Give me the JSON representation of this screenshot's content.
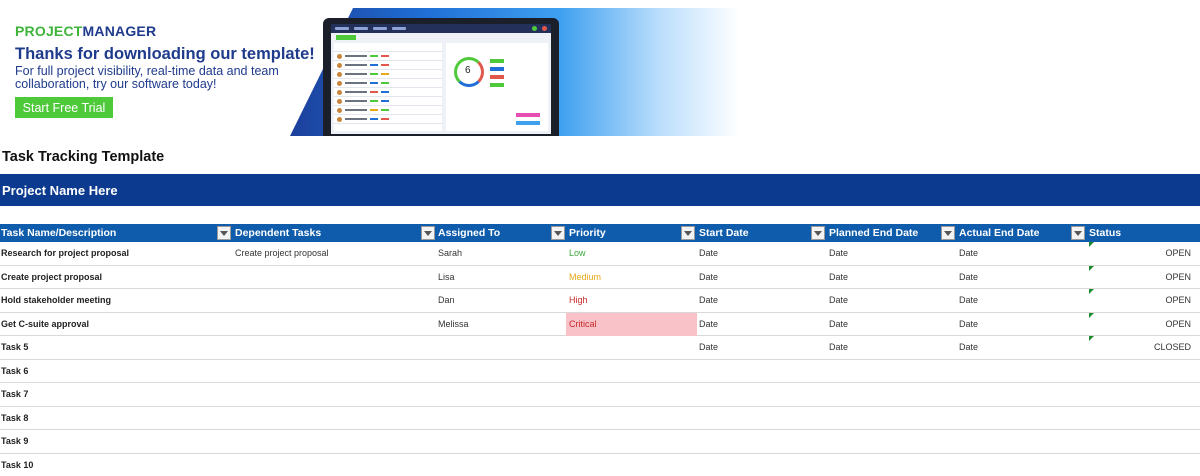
{
  "banner": {
    "logo_part1": "PROJECT",
    "logo_part2": "MANAGER",
    "headline": "Thanks for downloading our template!",
    "promo_text": "For full project visibility, real-time data and team collaboration, try our software today!",
    "cta_label": "Start Free Trial",
    "gauge_number": "6"
  },
  "sheet_title": "Task Tracking Template",
  "project_name": "Project Name Here",
  "columns": [
    "Task Name/Description",
    "Dependent Tasks",
    "Assigned To",
    "Priority",
    "Start Date",
    "Planned End Date",
    "Actual End Date",
    "Status"
  ],
  "rows": [
    {
      "name": "Research for project proposal",
      "dependent": "Create project proposal",
      "assigned": "Sarah",
      "priority": "Low",
      "start": "Date",
      "planned_end": "Date",
      "actual_end": "Date",
      "status": "OPEN"
    },
    {
      "name": "Create project proposal",
      "dependent": "",
      "assigned": "Lisa",
      "priority": "Medium",
      "start": "Date",
      "planned_end": "Date",
      "actual_end": "Date",
      "status": "OPEN"
    },
    {
      "name": "Hold stakeholder meeting",
      "dependent": "",
      "assigned": "Dan",
      "priority": "High",
      "start": "Date",
      "planned_end": "Date",
      "actual_end": "Date",
      "status": "OPEN"
    },
    {
      "name": "Get C-suite approval",
      "dependent": "",
      "assigned": "Melissa",
      "priority": "Critical",
      "start": "Date",
      "planned_end": "Date",
      "actual_end": "Date",
      "status": "OPEN"
    },
    {
      "name": "Task 5",
      "dependent": "",
      "assigned": "",
      "priority": "",
      "start": "Date",
      "planned_end": "Date",
      "actual_end": "Date",
      "status": "CLOSED"
    },
    {
      "name": "Task 6",
      "dependent": "",
      "assigned": "",
      "priority": "",
      "start": "",
      "planned_end": "",
      "actual_end": "",
      "status": ""
    },
    {
      "name": "Task 7",
      "dependent": "",
      "assigned": "",
      "priority": "",
      "start": "",
      "planned_end": "",
      "actual_end": "",
      "status": ""
    },
    {
      "name": "Task 8",
      "dependent": "",
      "assigned": "",
      "priority": "",
      "start": "",
      "planned_end": "",
      "actual_end": "",
      "status": ""
    },
    {
      "name": "Task 9",
      "dependent": "",
      "assigned": "",
      "priority": "",
      "start": "",
      "planned_end": "",
      "actual_end": "",
      "status": ""
    },
    {
      "name": "Task 10",
      "dependent": "",
      "assigned": "",
      "priority": "",
      "start": "",
      "planned_end": "",
      "actual_end": "",
      "status": ""
    }
  ],
  "colors": {
    "header_blue": "#0f5cac",
    "project_bar": "#0b3a8e",
    "brand_green": "#4ec93a",
    "brand_navy": "#1f3b8c",
    "priority_low": "#3aa63a",
    "priority_medium": "#e6a817",
    "priority_high": "#c62828",
    "priority_critical_bg": "#f8c2c8",
    "priority_critical_text": "#c62828",
    "status_marker": "#1e8a2c"
  }
}
